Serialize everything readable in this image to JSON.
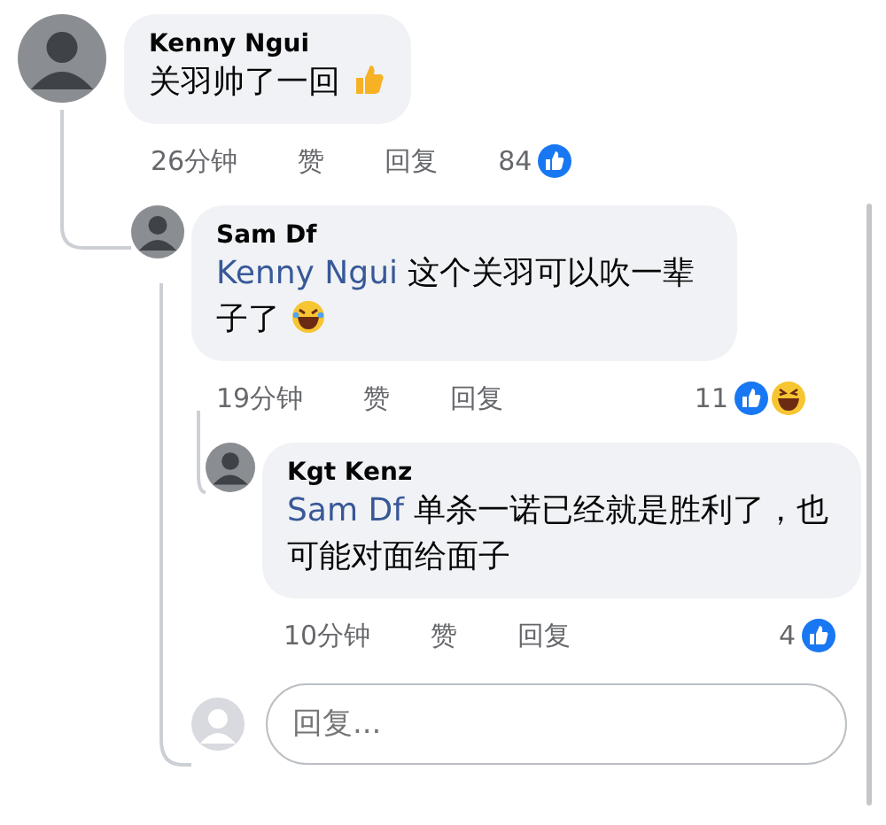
{
  "comments": [
    {
      "author": "Kenny Ngui",
      "text": "关羽帅了一回",
      "emoji": {
        "kind": "thumbs-up"
      },
      "time": "26分钟",
      "like": "赞",
      "reply": "回复",
      "count": "84",
      "reactions": [
        {
          "kind": "like"
        }
      ],
      "children": [
        {
          "author": "Sam Df",
          "mention": "Kenny Ngui",
          "text": "这个关羽可以吹一辈子了",
          "emoji": {
            "kind": "laughing"
          },
          "time": "19分钟",
          "like": "赞",
          "reply": "回复",
          "count": "11",
          "reactions": [
            {
              "kind": "like"
            },
            {
              "kind": "haha"
            }
          ],
          "children": [
            {
              "author": "Kgt Kenz",
              "mention": "Sam Df",
              "text": "单杀一诺已经就是胜利了，也可能对面给面子",
              "time": "10分钟",
              "like": "赞",
              "reply": "回复",
              "count": "4",
              "reactions": [
                {
                  "kind": "like"
                }
              ]
            }
          ]
        }
      ]
    }
  ],
  "reply_field": {
    "placeholder": "回复..."
  }
}
